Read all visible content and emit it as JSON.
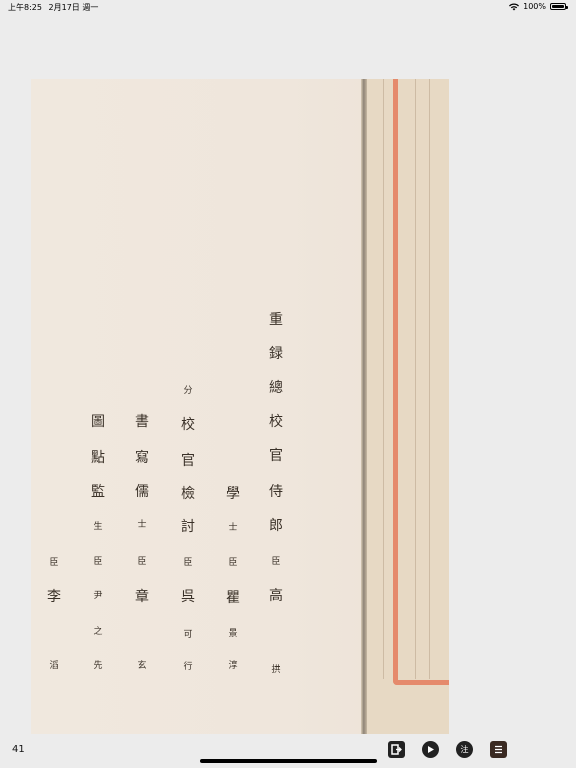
{
  "status_bar": {
    "time": "上午8:25",
    "date": "2月17日 週一",
    "battery": "100%"
  },
  "page": {
    "columns": [
      [
        "重",
        "録",
        "總",
        "校",
        "官",
        "侍",
        "郎",
        "臣",
        "高",
        "拱"
      ],
      [
        "學",
        "士",
        "臣",
        "瞿",
        "景",
        "淳"
      ],
      [
        "分",
        "校",
        "官",
        "檢",
        "討",
        "臣",
        "呉",
        "可",
        "行"
      ],
      [
        "書",
        "寫",
        "儒",
        "士",
        "臣",
        "章",
        "玄"
      ],
      [
        "圖",
        "點",
        "監",
        "生",
        "臣",
        "尹",
        "之",
        "先"
      ],
      [
        "臣",
        "李",
        "滔"
      ]
    ]
  },
  "footer": {
    "page_number": "41"
  },
  "toolbar": {
    "note_label": "注"
  }
}
